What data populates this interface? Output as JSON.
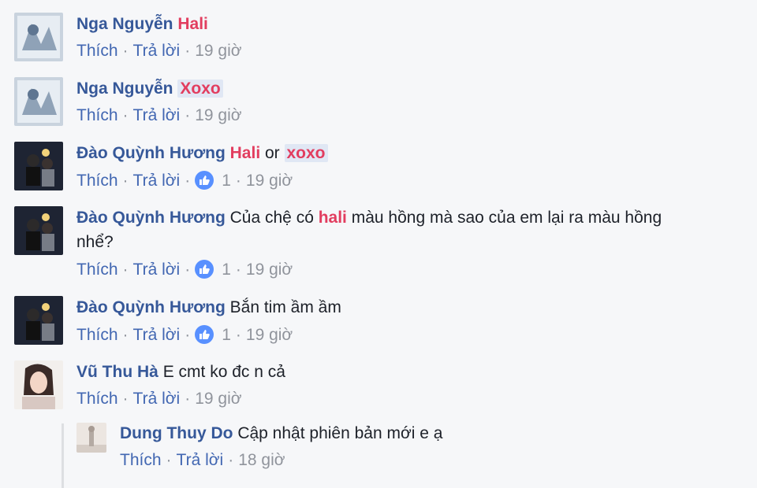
{
  "comments": [
    {
      "author": "Nga Nguyễn",
      "tag": "Hali",
      "like": "Thích",
      "reply": "Trả lời",
      "time": "19 giờ"
    },
    {
      "author": "Nga Nguyễn",
      "tag": "Xoxo",
      "like": "Thích",
      "reply": "Trả lời",
      "time": "19 giờ"
    },
    {
      "author": "Đào Quỳnh Hương",
      "tag1": "Hali",
      "mid": " or ",
      "tag2": "xoxo",
      "like": "Thích",
      "reply": "Trả lời",
      "reactions": "1",
      "time": "19 giờ"
    },
    {
      "author": "Đào Quỳnh Hương",
      "pre": "Của chệ có ",
      "tag": "hali",
      "post": " màu hồng mà sao của em lại ra màu hồng nhể?",
      "like": "Thích",
      "reply": "Trả lời",
      "reactions": "1",
      "time": "19 giờ"
    },
    {
      "author": "Đào Quỳnh Hương",
      "text": "Bắn tim ầm ầm",
      "like": "Thích",
      "reply": "Trả lời",
      "reactions": "1",
      "time": "19 giờ"
    },
    {
      "author": "Vũ Thu Hà",
      "text": "E cmt ko đc n cả",
      "like": "Thích",
      "reply": "Trả lời",
      "time": "19 giờ"
    }
  ],
  "reply": {
    "author": "Dung Thuy Do",
    "text": "Cập nhật phiên bản mới e ạ",
    "like": "Thích",
    "reply": "Trả lời",
    "time": "18 giờ"
  },
  "colors": {
    "author": "#365899",
    "tag": "#e23d5f",
    "like_badge": "#5890ff",
    "background": "#f6f7f9"
  },
  "icons": {
    "like_badge": "thumbs-up-icon"
  }
}
